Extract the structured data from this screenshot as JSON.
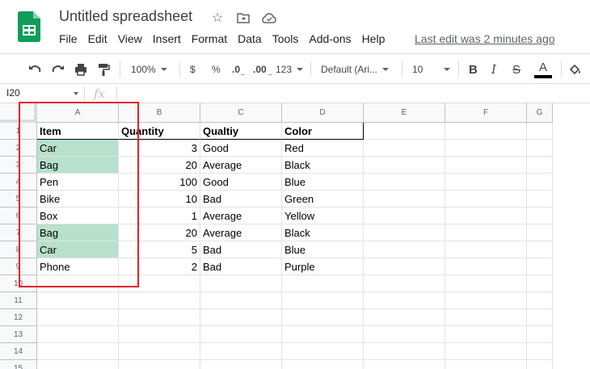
{
  "doc": {
    "title": "Untitled spreadsheet",
    "last_edit": "Last edit was 2 minutes ago"
  },
  "menu": [
    "File",
    "Edit",
    "View",
    "Insert",
    "Format",
    "Data",
    "Tools",
    "Add-ons",
    "Help"
  ],
  "toolbar": {
    "zoom": "100%",
    "currency": "$",
    "percent": "%",
    "decrease_decimals": ".0",
    "increase_decimals": ".00",
    "more_formats": "123",
    "font": "Default (Ari...",
    "font_size": "10",
    "bold": "B",
    "italic": "I",
    "strike": "S",
    "text_color": "A"
  },
  "formula_bar": {
    "name_box": "I20",
    "fx": "fx",
    "value": ""
  },
  "columns": [
    "A",
    "B",
    "C",
    "D",
    "E",
    "F",
    "G"
  ],
  "rows": [
    "1",
    "2",
    "3",
    "4",
    "5",
    "6",
    "7",
    "8",
    "9",
    "10",
    "11",
    "12",
    "13",
    "14",
    "15"
  ],
  "table": {
    "headers": [
      "Item",
      "Quantity",
      "Qualtiy",
      "Color"
    ],
    "rows": [
      [
        "Car",
        "3",
        "Good",
        "Red"
      ],
      [
        "Bag",
        "20",
        "Average",
        "Black"
      ],
      [
        "Pen",
        "100",
        "Good",
        "Blue"
      ],
      [
        "Bike",
        "10",
        "Bad",
        "Green"
      ],
      [
        "Box",
        "1",
        "Average",
        "Yellow"
      ],
      [
        "Bag",
        "20",
        "Average",
        "Black"
      ],
      [
        "Car",
        "5",
        "Bad",
        "Blue"
      ],
      [
        "Phone",
        "2",
        "Bad",
        "Purple"
      ]
    ],
    "highlighted_rows": [
      0,
      1,
      5,
      6
    ]
  },
  "colors": {
    "highlight": "#b7e1cd",
    "annotation": "#e8202a",
    "sheets_green": "#0f9d58"
  }
}
